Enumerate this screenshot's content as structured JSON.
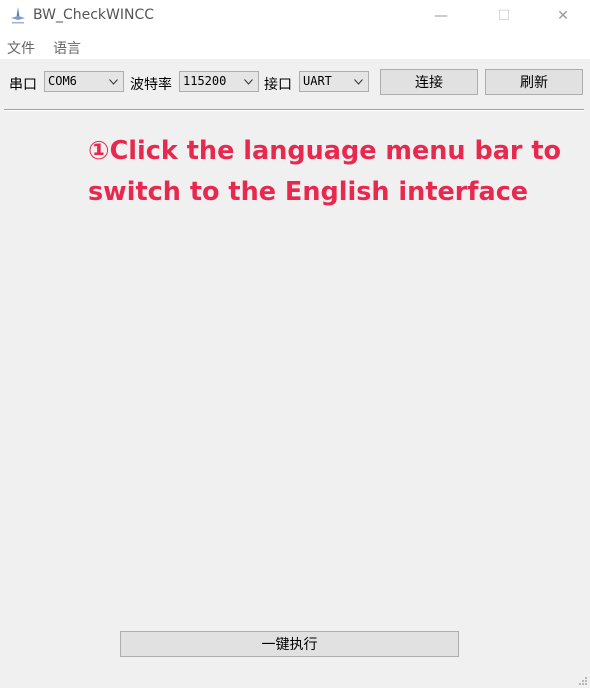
{
  "window": {
    "title": "BW_CheckWINCC",
    "minimize_glyph": "—",
    "maximize_glyph": "☐",
    "close_glyph": "✕"
  },
  "menu": {
    "file": "文件",
    "language": "语言"
  },
  "toolbar": {
    "port_label": "串口",
    "port_value": "COM6",
    "baud_label": "波特率",
    "baud_value": "115200",
    "interface_label": "接口",
    "interface_value": "UART",
    "connect_label": "连接",
    "refresh_label": "刷新"
  },
  "annotation": {
    "text": "①Click the language menu bar to switch to the English interface",
    "color": "#e8294f"
  },
  "footer": {
    "execute_label": "一键执行"
  },
  "icons": [
    "app-icon",
    "minimize-icon",
    "maximize-icon",
    "close-icon",
    "chevron-down-icon",
    "resize-grip-icon"
  ]
}
